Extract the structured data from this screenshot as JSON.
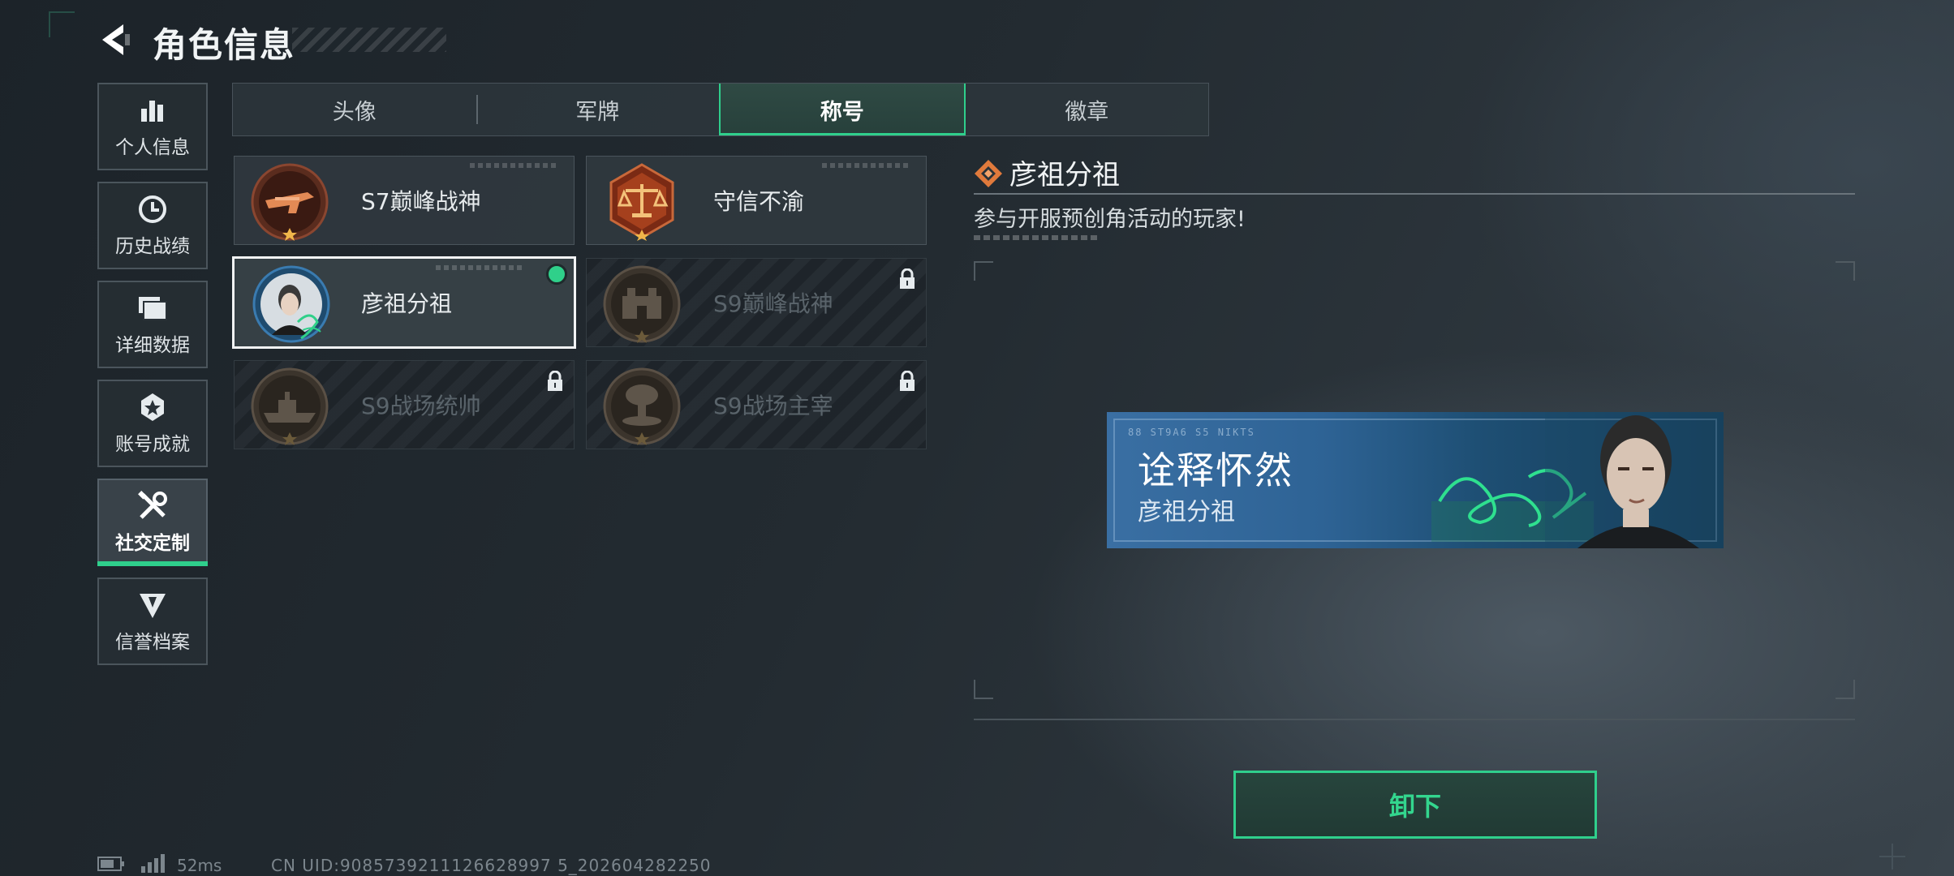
{
  "header": {
    "title": "角色信息",
    "back_icon": "back-arrow-icon"
  },
  "sidebar": {
    "items": [
      {
        "label": "个人信息",
        "icon": "bar-chart-icon"
      },
      {
        "label": "历史战绩",
        "icon": "clock-icon"
      },
      {
        "label": "详细数据",
        "icon": "folder-icon"
      },
      {
        "label": "账号成就",
        "icon": "achievement-icon"
      },
      {
        "label": "社交定制",
        "icon": "tools-icon",
        "active": true
      },
      {
        "label": "信誉档案",
        "icon": "shield-icon"
      }
    ]
  },
  "tabs": [
    {
      "label": "头像"
    },
    {
      "label": "军牌"
    },
    {
      "label": "称号",
      "active": true
    },
    {
      "label": "徽章"
    }
  ],
  "titles": [
    {
      "label": "S7巅峰战神",
      "locked": false,
      "icon": "weapon-medal-icon"
    },
    {
      "label": "守信不渝",
      "locked": false,
      "icon": "scales-medal-icon"
    },
    {
      "label": "彦祖分祖",
      "locked": false,
      "selected": true,
      "equipped": true,
      "icon": "portrait-medal-icon"
    },
    {
      "label": "S9巅峰战神",
      "locked": true,
      "icon": "fortress-medal-icon"
    },
    {
      "label": "S9战场统帅",
      "locked": true,
      "icon": "ship-medal-icon"
    },
    {
      "label": "S9战场主宰",
      "locked": true,
      "icon": "explosion-medal-icon"
    }
  ],
  "detail": {
    "title": "彦祖分祖",
    "description": "参与开服预创角活动的玩家!",
    "banner": {
      "main_text": "诠释怀然",
      "sub_text": "彦祖分祖",
      "code_text": "88 ST9A6   S5 NIKTS"
    }
  },
  "unequip_button": {
    "label": "卸下"
  },
  "status_bar": {
    "ping": "52ms",
    "uid": "CN UID:9085739211126628997 5_202604282250"
  },
  "colors": {
    "accent": "#2fcf8c",
    "medal_orange": "#e07a3c"
  }
}
